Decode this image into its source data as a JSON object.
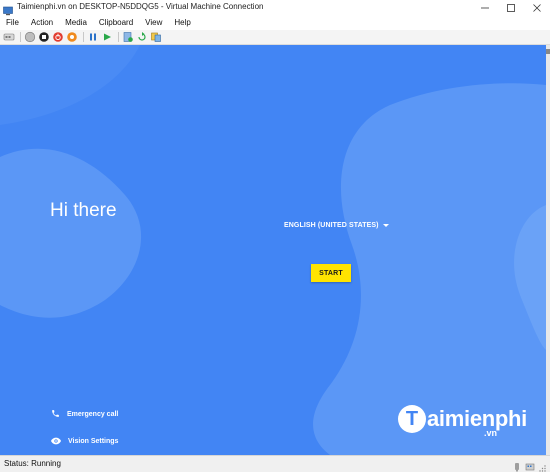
{
  "window": {
    "title": "Taimienphi.vn on DESKTOP-N5DDQG5 - Virtual Machine Connection",
    "controls": [
      "minimize-icon",
      "maximize-icon",
      "close-icon"
    ]
  },
  "menu": {
    "items": [
      "File",
      "Action",
      "Media",
      "Clipboard",
      "View",
      "Help"
    ]
  },
  "toolbar": {
    "buttons": [
      "ctrl-alt-del-icon",
      "start-icon",
      "turn-off-icon",
      "shut-down-icon",
      "save-icon",
      "pause-icon",
      "reset-icon",
      "checkpoint-icon",
      "revert-icon",
      "enhanced-session-icon"
    ]
  },
  "screen": {
    "greeting": "Hi there",
    "language": "ENGLISH (UNITED STATES)",
    "start_label": "START",
    "emergency_label": "Emergency call",
    "vision_label": "Vision Settings",
    "watermark": "aimienphi",
    "watermark_initial": "T",
    "watermark_suffix": ".vn",
    "colors": {
      "background": "#4285f4",
      "wave": "#5b97f6",
      "start_button": "#ffe400"
    }
  },
  "status": {
    "text": "Status: Running"
  }
}
